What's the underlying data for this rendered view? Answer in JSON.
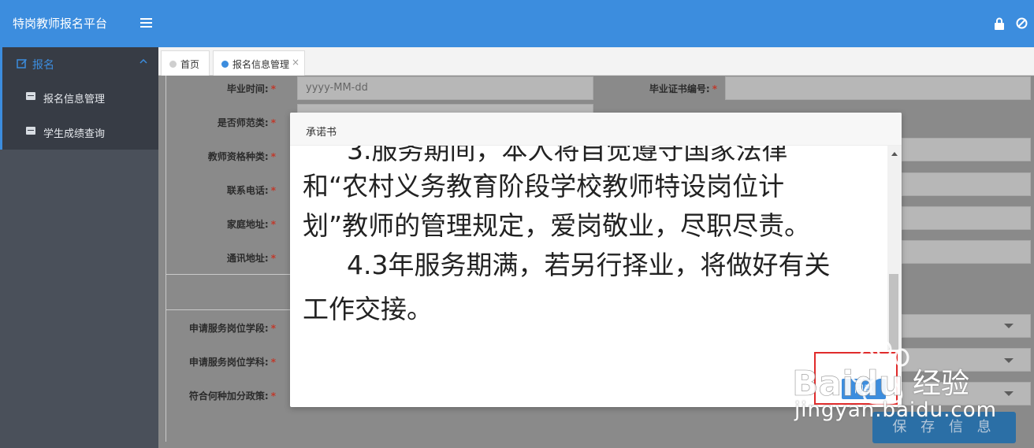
{
  "header": {
    "title": "特岗教师报名平台"
  },
  "sidebar": {
    "parent": {
      "label": "报名"
    },
    "items": [
      {
        "label": "报名信息管理"
      },
      {
        "label": "学生成绩查询"
      }
    ]
  },
  "tabs": [
    {
      "label": "首页"
    },
    {
      "label": "报名信息管理",
      "close": "×"
    }
  ],
  "form": {
    "rows": [
      {
        "label": "毕业时间:",
        "placeholder": "yyyy-MM-dd"
      },
      {
        "label": "是否师范类:"
      },
      {
        "label": "教师资格种类:"
      },
      {
        "label": "联系电话:"
      },
      {
        "label": "家庭地址:"
      },
      {
        "label": "通讯地址:"
      },
      {
        "label": "申请服务岗位学段:"
      },
      {
        "label": "申请服务岗位学科:"
      },
      {
        "label": "符合何种加分政策:"
      }
    ],
    "right_label": "毕业证书编号:",
    "required_mark": "*"
  },
  "save_button": "保 存 信 息",
  "modal": {
    "title": "承诺书",
    "lines": [
      "3.服务期间，本人将自觉遵守国家法律",
      "和“农村义务教育阶段学校教师特设岗位计",
      "划”教师的管理规定，爱岗敬业，尽职尽责。",
      "4.3年服务期满，若另行择业，将做好有关",
      "工作交接。"
    ],
    "agree_button": "同意"
  },
  "watermark": {
    "brand": "Baidu",
    "product": "经验",
    "url": "jingyan.baidu.com"
  }
}
